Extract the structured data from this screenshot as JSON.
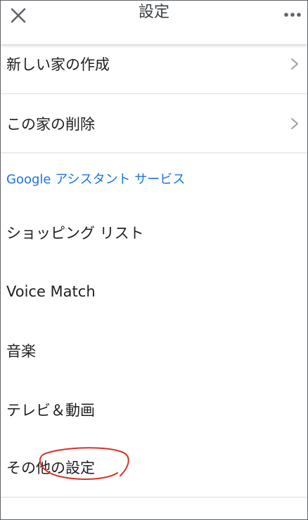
{
  "header": {
    "title": "設定",
    "close_icon": "close-icon",
    "more_icon": "more-horizontal-icon"
  },
  "items": [
    {
      "label": "新しい家の作成",
      "chevron": true
    },
    {
      "label": "この家の削除",
      "chevron": true
    }
  ],
  "section": {
    "title": "Google アシスタント サービス",
    "color": "#1a73e8"
  },
  "assistant_items": [
    {
      "label": "ショッピング リスト"
    },
    {
      "label": "Voice Match"
    },
    {
      "label": "音楽"
    },
    {
      "label": "テレビ＆動画"
    },
    {
      "label": "その他の設定"
    }
  ],
  "annotation": {
    "color": "#d93025"
  }
}
